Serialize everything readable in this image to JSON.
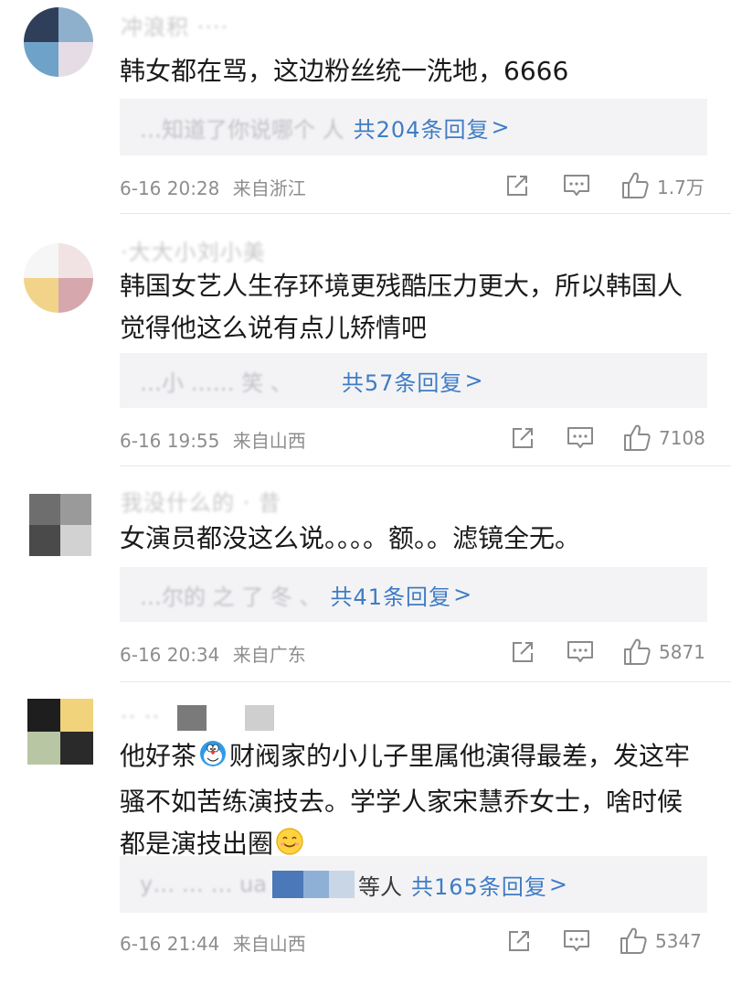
{
  "comments": [
    {
      "username": "冲浪积 ····",
      "text": "韩女都在骂，这边粉丝统一洗地，6666",
      "reply_names": "…知道了你说哪个 人",
      "reply_count": "共204条回复",
      "reply_suffix": ">",
      "time": "6-16 20:28",
      "location": "来自浙江",
      "likes": "1.7万"
    },
    {
      "username": "·大大小刘小美",
      "text": "韩国女艺人生存环境更残酷压力更大，所以韩国人觉得他这么说有点儿矫情吧",
      "reply_names": "…小 …… 笑 、",
      "reply_count": "共57条回复",
      "reply_suffix": ">",
      "time": "6-16 19:55",
      "location": "来自山西",
      "likes": "7108"
    },
    {
      "username": "我没什么的 · 昔",
      "text": "女演员都没这么说。。。。额。。滤镜全无。",
      "reply_names": "…尔的 之 了 冬 、",
      "reply_count": "共41条回复",
      "reply_suffix": ">",
      "time": "6-16 20:34",
      "location": "来自广东",
      "likes": "5871"
    },
    {
      "username": "·· ··",
      "text_parts": [
        "他好茶",
        "财阀家的小儿子里属他演得最差，发这牢骚不如苦练演技去。学学人家宋慧乔女士，啥时候都是演技出圈"
      ],
      "reply_names": "y… … … ua",
      "reply_tail": "等人",
      "reply_count": "共165条回复",
      "reply_suffix": ">",
      "time": "6-16 21:44",
      "location": "来自山西",
      "likes": "5347"
    }
  ],
  "icons": {
    "share": "share-icon",
    "comment": "comment-icon",
    "like": "like-icon"
  },
  "colors": {
    "link": "#3f7cc4",
    "meta": "#8d8d8d",
    "reply_bg": "#f3f3f5"
  }
}
